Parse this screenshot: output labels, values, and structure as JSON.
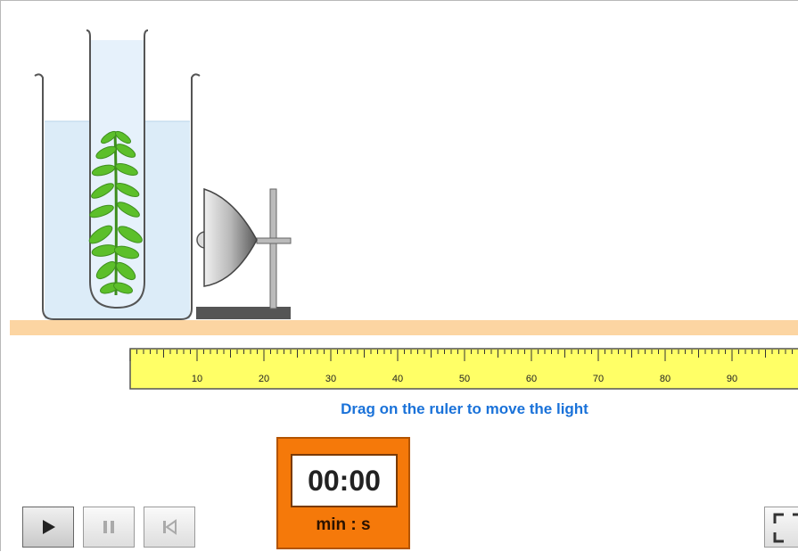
{
  "ruler": {
    "labels": [
      "10",
      "20",
      "30",
      "40",
      "50",
      "60",
      "70",
      "80",
      "90"
    ],
    "instruction": "Drag on the ruler to move the light"
  },
  "timer": {
    "display": "00:00",
    "units": "min : s"
  },
  "controls": {
    "play_icon": "play-icon",
    "pause_icon": "pause-icon",
    "reset_icon": "skip-to-start-icon",
    "fullscreen_icon": "fullscreen-icon"
  },
  "colors": {
    "bench": "#fcd5a2",
    "ruler": "#ffff66",
    "instruction": "#1a72d9",
    "timer_bg": "#f5790a",
    "water": "#dcecf8",
    "plant": "#5cbf2a"
  }
}
